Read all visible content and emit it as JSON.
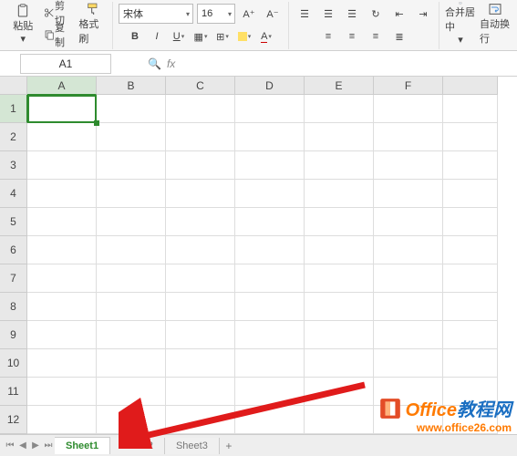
{
  "ribbon": {
    "paste": "粘贴",
    "cut": "剪切",
    "copy": "复制",
    "format_painter": "格式刷",
    "font_name": "宋体",
    "font_size": "16",
    "merge_center": "合并居中",
    "auto_wrap": "自动换行"
  },
  "namebox": {
    "value": "A1"
  },
  "fx": {
    "label": "fx"
  },
  "columns": [
    "A",
    "B",
    "C",
    "D",
    "E",
    "F"
  ],
  "rows": [
    "1",
    "2",
    "3",
    "4",
    "5",
    "6",
    "7",
    "8",
    "9",
    "10",
    "11",
    "12"
  ],
  "selected_cell": "A1",
  "sheets": {
    "active": 0,
    "tabs": [
      "Sheet1",
      "Sheet2",
      "Sheet3"
    ]
  },
  "watermark": {
    "title_prefix": "Office",
    "title_suffix": "教程网",
    "url": "www.office26.com"
  }
}
